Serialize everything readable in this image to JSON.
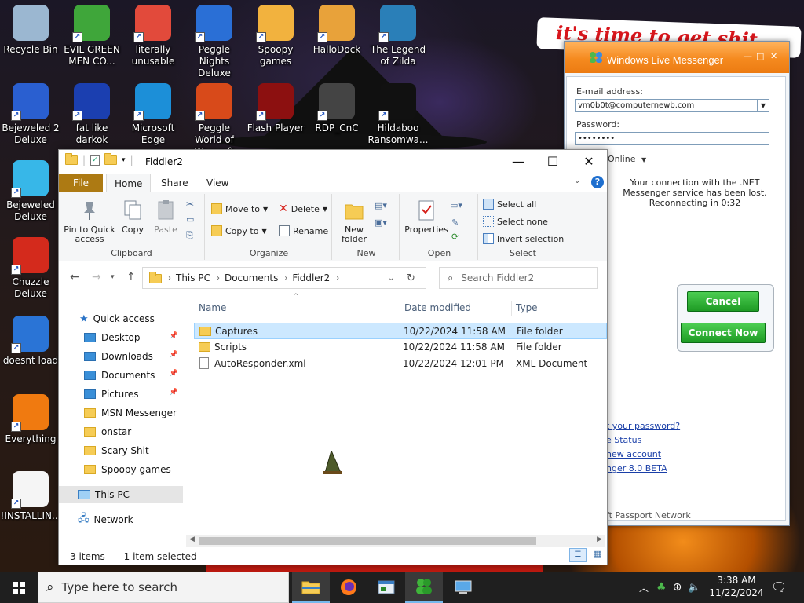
{
  "desktop": {
    "banner_text": "it's time to get shit",
    "icons": [
      {
        "label": "Recycle Bin",
        "icon": "recycle-bin-icon",
        "color": "#9bb7d1"
      },
      {
        "label": "EVIL GREEN MEN CO...",
        "icon": "msn-buddy-icon",
        "color": "#3fa63a"
      },
      {
        "label": "literally unusable",
        "icon": "chrome-icon",
        "color": "#e24a3b"
      },
      {
        "label": "Peggle Nights Deluxe",
        "icon": "peggle-icon",
        "color": "#2a6fd6"
      },
      {
        "label": "Spoopy games",
        "icon": "folder-icon",
        "color": "#f2b23e"
      },
      {
        "label": "HalloDock",
        "icon": "windows-shield-icon",
        "color": "#e8a23a"
      },
      {
        "label": "The Legend of Zilda",
        "icon": "zelda-icon",
        "color": "#2a7fb8"
      },
      {
        "label": "Bejeweled 2 Deluxe",
        "icon": "bejeweled-icon",
        "color": "#2a5fd0"
      },
      {
        "label": "fat like darkok",
        "icon": "mpl-icon",
        "color": "#1b3fb0"
      },
      {
        "label": "Microsoft Edge",
        "icon": "edge-icon",
        "color": "#1c8fd8"
      },
      {
        "label": "Peggle World of Warcraft",
        "icon": "peggle-wow-icon",
        "color": "#d84a1a"
      },
      {
        "label": "Flash Player",
        "icon": "flash-icon",
        "color": "#8c1010"
      },
      {
        "label": "RDP_CnC",
        "icon": "rdp-icon",
        "color": "#444"
      },
      {
        "label": "Hildaboo Ransomwa...",
        "icon": "yashma-icon",
        "color": "#111"
      },
      {
        "label": "Bejeweled Deluxe",
        "icon": "diamond-icon",
        "color": "#37b7e8"
      },
      {
        "label": "Chuzzle Deluxe",
        "icon": "chuzzle-icon",
        "color": "#d42a1c"
      },
      {
        "label": "doesnt load",
        "icon": "thunderbird-icon",
        "color": "#2a74d6"
      },
      {
        "label": "Everything",
        "icon": "everything-icon",
        "color": "#f07a10"
      },
      {
        "label": "!INSTALLIN...",
        "icon": "text-file-icon",
        "color": "#f5f5f5"
      }
    ]
  },
  "messenger": {
    "title": "Windows Live Messenger",
    "email_label": "E-mail address:",
    "email_value": "vm0b0t@computernewb.com",
    "password_label": "Password:",
    "password_value": "••••••••",
    "status_label": "Online",
    "connection_msg": "Your connection with the .NET Messenger service has been lost. Reconnecting in 0:32",
    "cancel_label": "Cancel",
    "connect_label": "Connect Now",
    "links": [
      "t your password?",
      "e Status",
      "new account",
      "nger 8.0 BETA"
    ],
    "footer": "ft Passport Network"
  },
  "explorer": {
    "title": "Fiddler2",
    "tabs": {
      "file": "File",
      "home": "Home",
      "share": "Share",
      "view": "View"
    },
    "ribbon": {
      "clipboard": {
        "name": "Clipboard",
        "pin": "Pin to Quick access",
        "copy": "Copy",
        "paste": "Paste"
      },
      "organize": {
        "name": "Organize",
        "move_to": "Move to",
        "copy_to": "Copy to",
        "delete": "Delete",
        "rename": "Rename"
      },
      "new": {
        "name": "New",
        "new_folder": "New folder"
      },
      "open": {
        "name": "Open",
        "properties": "Properties"
      },
      "select": {
        "name": "Select",
        "select_all": "Select all",
        "select_none": "Select none",
        "invert": "Invert selection"
      }
    },
    "breadcrumb": [
      "This PC",
      "Documents",
      "Fiddler2"
    ],
    "search_placeholder": "Search Fiddler2",
    "nav": {
      "quick_access": "Quick access",
      "items": [
        "Desktop",
        "Downloads",
        "Documents",
        "Pictures",
        "MSN Messenger",
        "onstar",
        "Scary Shit",
        "Spoopy games"
      ],
      "this_pc": "This PC",
      "network": "Network"
    },
    "columns": {
      "name": "Name",
      "date": "Date modified",
      "type": "Type"
    },
    "files": [
      {
        "name": "Captures",
        "date": "10/22/2024 11:58 AM",
        "type": "File folder",
        "selected": true
      },
      {
        "name": "Scripts",
        "date": "10/22/2024 11:58 AM",
        "type": "File folder",
        "selected": false
      },
      {
        "name": "AutoResponder.xml",
        "date": "10/22/2024 12:01 PM",
        "type": "XML Document",
        "selected": false
      }
    ],
    "status_items": "3 items",
    "status_selected": "1 item selected"
  },
  "taskbar": {
    "search_placeholder": "Type here to search",
    "time": "3:38 AM",
    "date": "11/22/2024"
  }
}
